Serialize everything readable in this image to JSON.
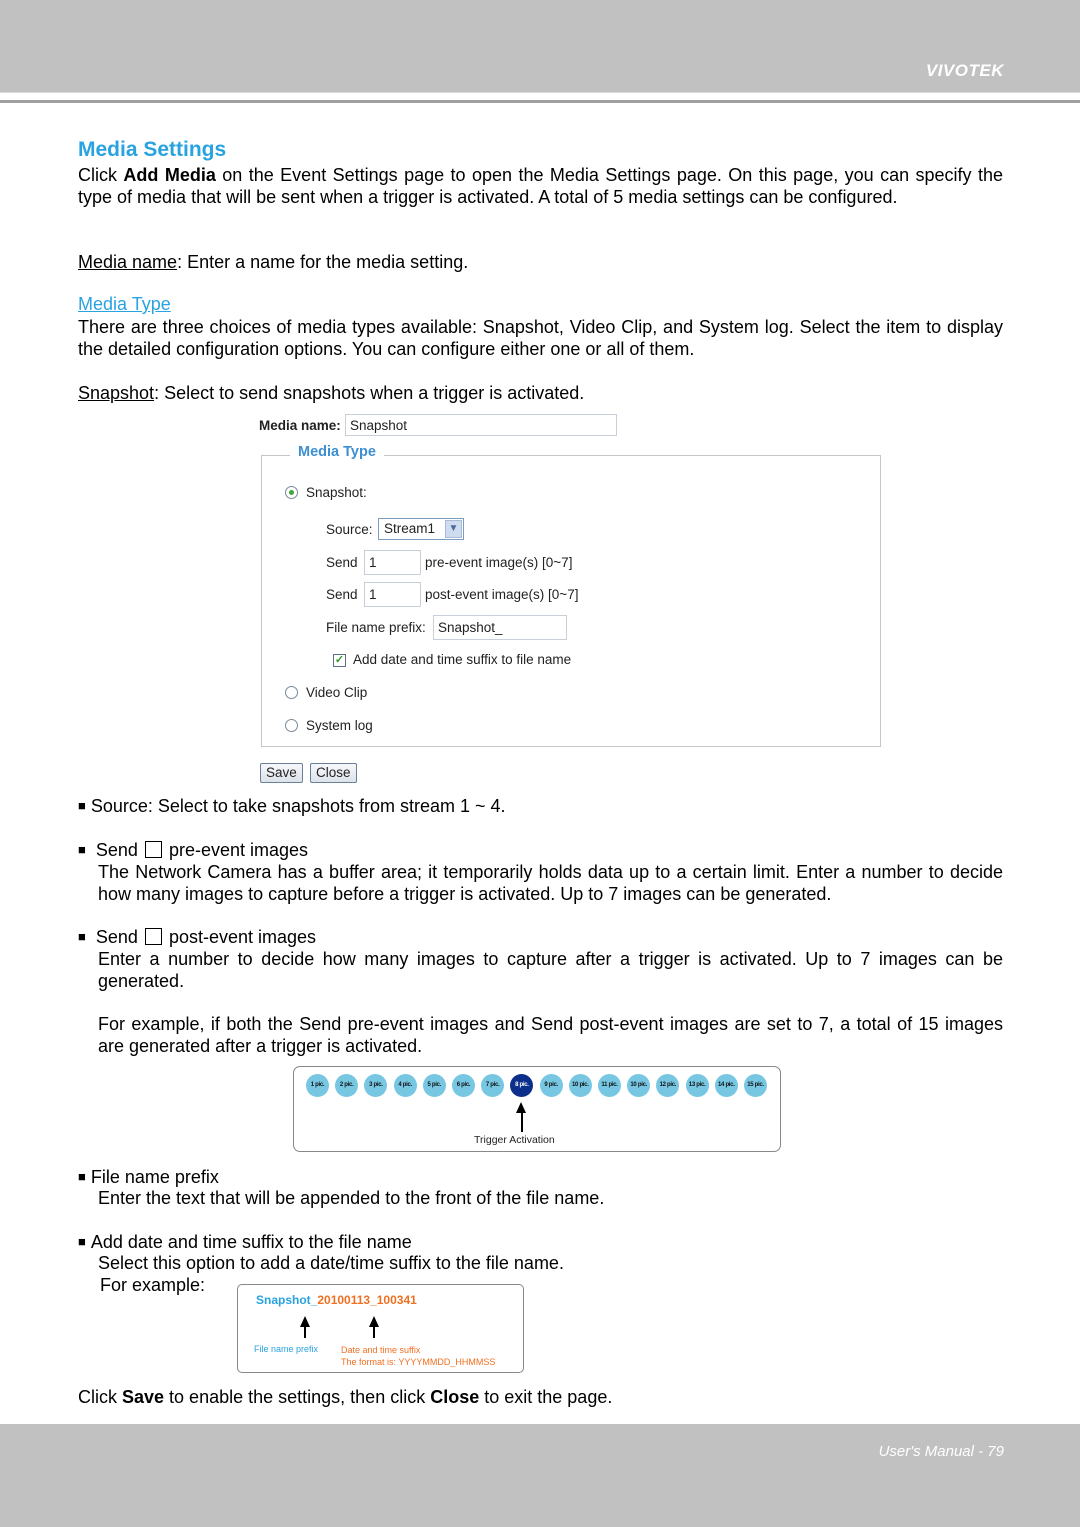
{
  "header": {
    "brand": "VIVOTEK"
  },
  "footer": {
    "page_label": "User's Manual - 79"
  },
  "section": {
    "title": "Media Settings",
    "intro_prefix": "Click ",
    "intro_bold": "Add Media",
    "intro_rest": " on the Event Settings page to open the Media Settings page. On this page, you can specify the type of media that will be sent when a trigger is activated. A total of 5 media settings can be configured.",
    "media_name_term": "Media name",
    "media_name_desc": ": Enter a name for the media setting.",
    "media_type_heading": "Media Type",
    "media_type_desc": "There are three choices of media types available: Snapshot, Video Clip, and System log. Select the item to display the detailed configuration options. You can configure either one or all of them.",
    "snapshot_term": "Snapshot",
    "snapshot_desc": ": Select to send snapshots when a trigger is activated."
  },
  "screenshot": {
    "media_name_label": "Media name:",
    "media_name_value": "Snapshot",
    "legend": "Media Type",
    "snapshot_option": "Snapshot:",
    "source_label": "Source:",
    "source_value": "Stream1",
    "send_label": "Send",
    "pre_event_value": "1",
    "pre_event_suffix": "pre-event image(s) [0~7]",
    "post_event_value": "1",
    "post_event_suffix": "post-event image(s) [0~7]",
    "prefix_label": "File name prefix:",
    "prefix_value": "Snapshot_",
    "suffix_checkbox_label": "Add date and time suffix to file name",
    "suffix_checked": true,
    "video_clip_option": "Video Clip",
    "system_log_option": "System log",
    "save_button": "Save",
    "close_button": "Close",
    "selected_option": "Snapshot"
  },
  "bullets": {
    "source": "Source: Select to take snapshots from stream 1 ~ 4.",
    "pre_title_a": "Send",
    "pre_title_b": "pre-event images",
    "pre_desc": "The Network Camera has a buffer area; it temporarily holds data up to a certain limit. Enter a number to decide how many images to capture before a trigger is activated. Up to 7 images can be generated.",
    "post_title_a": "Send",
    "post_title_b": "post-event images",
    "post_desc": "Enter a number to decide how many images to capture after a trigger is activated. Up to 7 images can be generated.",
    "example_desc": "For example, if both the Send pre-event images and Send post-event images are set to 7, a total of 15 images are generated after a trigger is activated.",
    "prefix_title": "File name prefix",
    "prefix_desc": "Enter the text that will be appended to the front of the file name.",
    "suffix_title": "Add date and time suffix to the file name",
    "suffix_desc": "Select this option to add a date/time suffix to the file name.",
    "for_example": "For example:"
  },
  "timeline": {
    "pics": [
      "1 pic.",
      "2 pic.",
      "3 pic.",
      "4 pic.",
      "5 pic.",
      "6 pic.",
      "7 pic.",
      "8 pic.",
      "9 pic.",
      "10 pic.",
      "11 pic.",
      "10 pic.",
      "12 pic.",
      "13 pic.",
      "14 pic.",
      "15 pic."
    ],
    "trigger_index": 7,
    "trigger_label": "Trigger Activation",
    "colors": {
      "normal": "#77c7e3",
      "trigger": "#0b2f8a"
    }
  },
  "filename_example": {
    "prefix_part": "Snapshot_",
    "suffix_part": "20100113_100341",
    "prefix_label": "File name prefix",
    "suffix_label": "Date and time suffix",
    "format_label": "The format is: YYYYMMDD_HHMMSS"
  },
  "closing": {
    "a": "Click ",
    "save": "Save",
    "b": " to enable the settings, then click ",
    "close": "Close",
    "c": " to exit the page."
  },
  "colors": {
    "heading_blue": "#29a3e0",
    "header_gray": "#c0c1c0",
    "orange": "#f07022"
  }
}
